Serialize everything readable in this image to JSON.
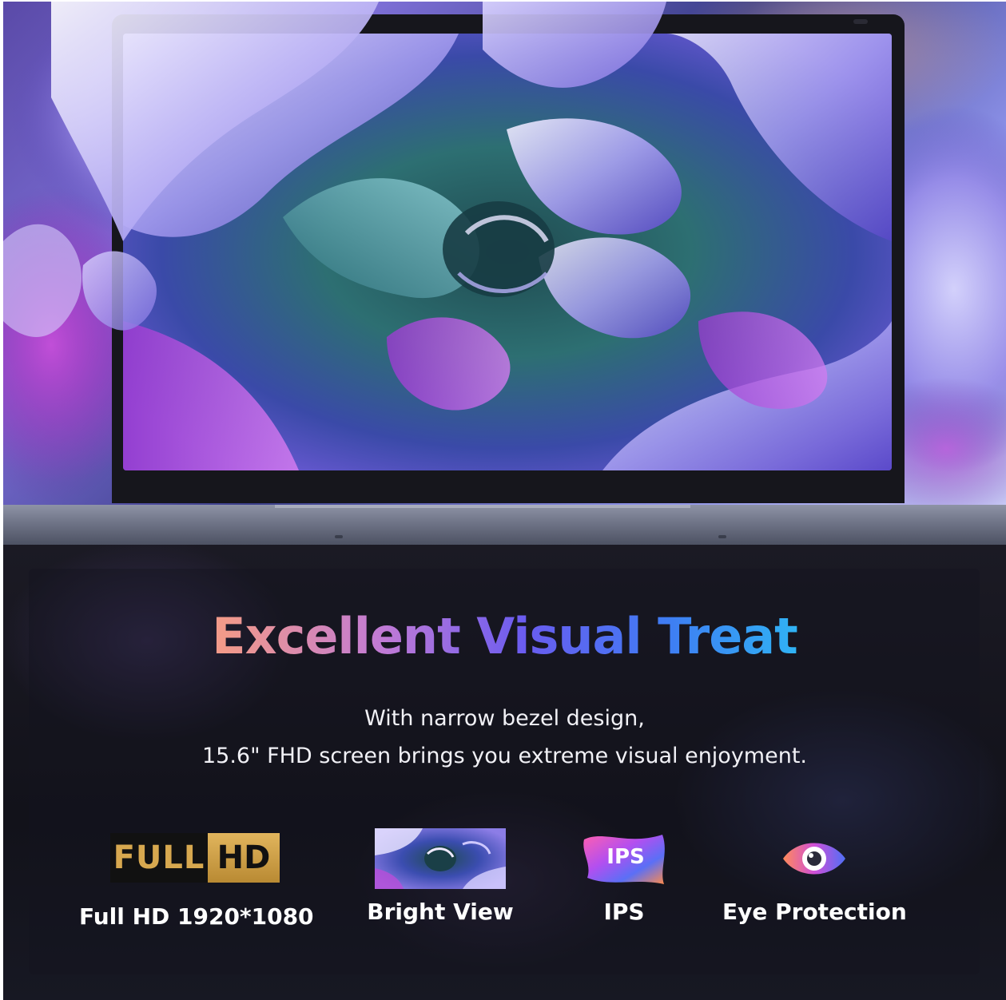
{
  "headline": "Excellent Visual Treat",
  "subtitle": {
    "line1": "With narrow bezel design,",
    "line2": "15.6\" FHD screen brings you extreme visual enjoyment."
  },
  "features": [
    {
      "icon": "full-hd-badge",
      "badge_left": "FULL",
      "badge_right": "HD",
      "label": "Full HD 1920*1080"
    },
    {
      "icon": "bright-view-thumbnail",
      "label": "Bright View"
    },
    {
      "icon": "ips-icon",
      "icon_text": "IPS",
      "label": "IPS"
    },
    {
      "icon": "eye-icon",
      "label": "Eye Protection"
    }
  ],
  "colors": {
    "headline_gradient": [
      "#f29a8a",
      "#c07ad6",
      "#6a5cf0",
      "#3f7cf3",
      "#2fb6f4"
    ],
    "badge_gold": "#d7a84f",
    "panel_background": "#14141e"
  }
}
